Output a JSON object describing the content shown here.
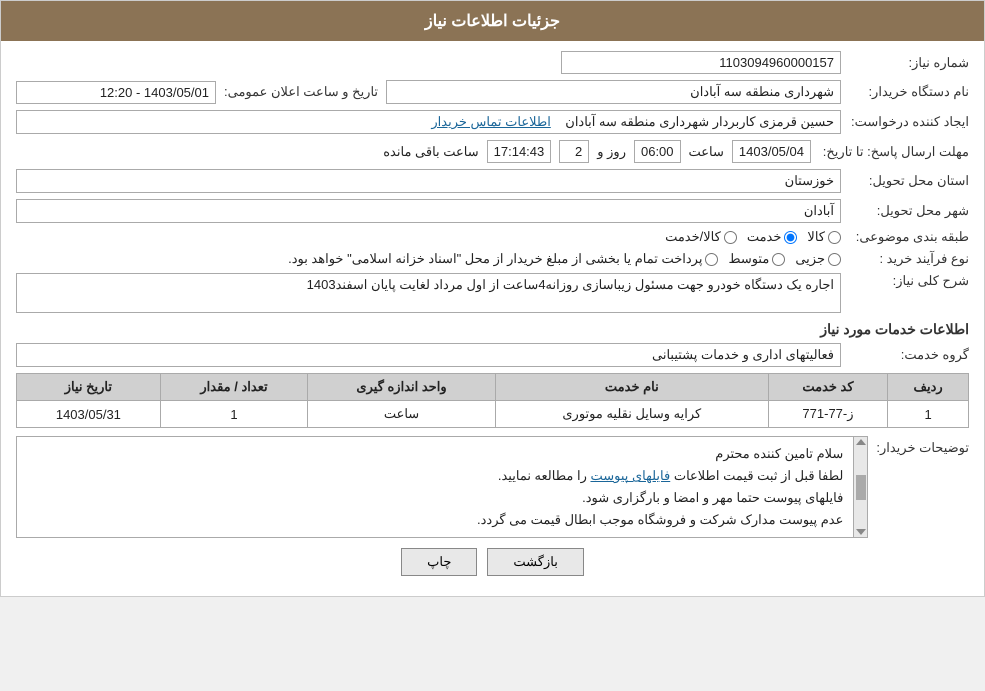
{
  "header": {
    "title": "جزئیات اطلاعات نیاز"
  },
  "fields": {
    "shomareNiaz_label": "شماره نیاز:",
    "shomareNiaz_value": "1103094960000157",
    "namDastgah_label": "نام دستگاه خریدار:",
    "namDastgah_value": "شهرداری منطقه سه آبادان",
    "tarikh_label": "تاریخ و ساعت اعلان عمومی:",
    "tarikh_value": "1403/05/01 - 12:20",
    "ejad_label": "ایجاد کننده درخواست:",
    "ejad_value": "حسین قرمزی کاربردار شهرداری منطقه سه آبادان",
    "ejad_link": "اطلاعات تماس خریدار",
    "mohlat_label": "مهلت ارسال پاسخ: تا تاریخ:",
    "mohlat_date": "1403/05/04",
    "mohlat_saat_label": "ساعت",
    "mohlat_saat": "06:00",
    "mohlat_rooz_label": "روز و",
    "mohlat_rooz": "2",
    "mohlat_baqi": "17:14:43",
    "mohlat_baqi_label": "ساعت باقی مانده",
    "ostan_label": "استان محل تحویل:",
    "ostan_value": "خوزستان",
    "shahr_label": "شهر محل تحویل:",
    "shahr_value": "آبادان",
    "tabaqe_label": "طبقه بندی موضوعی:",
    "tabaqe_options": [
      {
        "label": "کالا",
        "name": "tabaqe",
        "value": "kala"
      },
      {
        "label": "خدمت",
        "name": "tabaqe",
        "value": "khedmat"
      },
      {
        "label": "کالا/خدمت",
        "name": "tabaqe",
        "value": "kala_khedmat"
      }
    ],
    "tabaqe_selected": "khedmat",
    "naveFarayand_label": "نوع فرآیند خرید :",
    "naveFarayand_options": [
      {
        "label": "جزیی",
        "value": "jozi"
      },
      {
        "label": "متوسط",
        "value": "mottavasset"
      },
      {
        "label": "پرداخت تمام یا بخشی از مبلغ خریدار از محل \"اسناد خزانه اسلامی\" خواهد بود.",
        "value": "esnad"
      }
    ],
    "naveFarayand_note": "پرداخت تمام یا بخشی از مبلغ خریدار از محل \"اسناد خزانه اسلامی\" خواهد بود.",
    "sharh_label": "شرح کلی نیاز:",
    "sharh_value": "اجاره یک دستگاه خودرو جهت مسئول زیباسازی روزانه4ساعت از اول مرداد لغایت پایان اسفند1403",
    "khadamat_label": "اطلاعات خدمات مورد نیاز",
    "grohe_label": "گروه خدمت:",
    "grohe_value": "فعالیتهای اداری و خدمات پشتیبانی",
    "table": {
      "headers": [
        "ردیف",
        "کد خدمت",
        "نام خدمت",
        "واحد اندازه گیری",
        "تعداد / مقدار",
        "تاریخ نیاز"
      ],
      "rows": [
        {
          "radif": "1",
          "kod": "ز-77-771",
          "nam": "کرایه وسایل نقلیه موتوری",
          "vahed": "ساعت",
          "tedad": "1",
          "tarikh": "1403/05/31"
        }
      ]
    },
    "tosihaat_label": "توضیحات خریدار:",
    "tosihaat_lines": [
      "سلام تامین کننده محترم",
      "لطفا قبل از ثبت قیمت اطلاعات فایلهای پیوست را مطالعه نمایید.",
      "فایلهای پیوست حتما مهر و امضا و بارگزاری شود.",
      "عدم پیوست مدارک شرکت و فروشگاه موجب ابطال قیمت می گردد."
    ],
    "buttons": {
      "baz_gardashtan": "بازگشت",
      "chap": "چاپ"
    }
  }
}
